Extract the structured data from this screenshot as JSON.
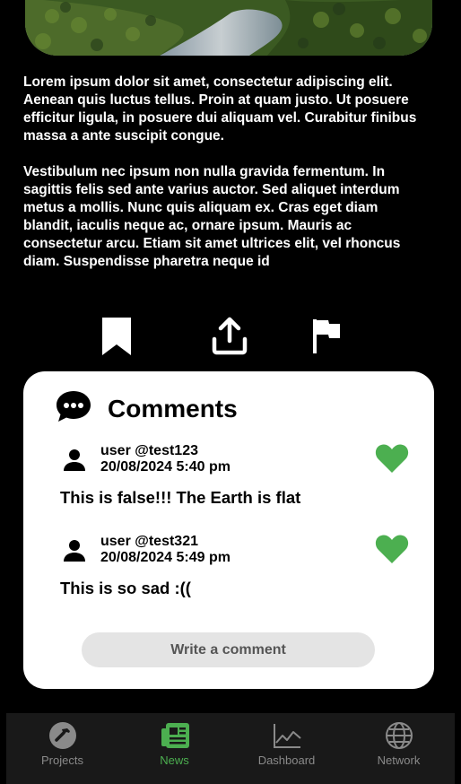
{
  "article": {
    "paragraph_1": "Lorem ipsum dolor sit amet, consectetur adipiscing elit. Aenean quis luctus tellus. Proin at quam justo. Ut posuere efficitur ligula, in posuere dui aliquam vel. Curabitur finibus massa a ante suscipit congue.",
    "paragraph_2": "Vestibulum nec ipsum non nulla gravida fermentum. In sagittis felis sed ante varius auctor. Sed aliquet interdum metus a mollis. Nunc quis aliquam ex. Cras eget diam blandit, iaculis neque ac, ornare ipsum. Mauris ac consectetur arcu. Etiam sit amet ultrices elit, vel rhoncus diam. Suspendisse pharetra neque id"
  },
  "actions": {
    "icons": [
      "bookmark-icon",
      "share-icon",
      "flag-icon"
    ]
  },
  "comments": {
    "title": "Comments",
    "items": [
      {
        "user": "user @test123",
        "date": "20/08/2024 5:40 pm",
        "text": "This is false!!! The Earth is flat",
        "liked": true
      },
      {
        "user": "user @test321",
        "date": "20/08/2024 5:49 pm",
        "text": "This is so sad :((",
        "liked": true
      }
    ],
    "write_label": "Write a comment"
  },
  "nav": {
    "items": [
      {
        "label": "Projects",
        "icon": "hammer-icon",
        "active": false
      },
      {
        "label": "News",
        "icon": "newspaper-icon",
        "active": true
      },
      {
        "label": "Dashboard",
        "icon": "line-chart-icon",
        "active": false
      },
      {
        "label": "Network",
        "icon": "globe-icon",
        "active": false
      }
    ]
  },
  "colors": {
    "background": "#000000",
    "card": "#ffffff",
    "accent_green": "#4caf50",
    "nav_background": "#191919",
    "nav_inactive": "#8a8a8a"
  }
}
